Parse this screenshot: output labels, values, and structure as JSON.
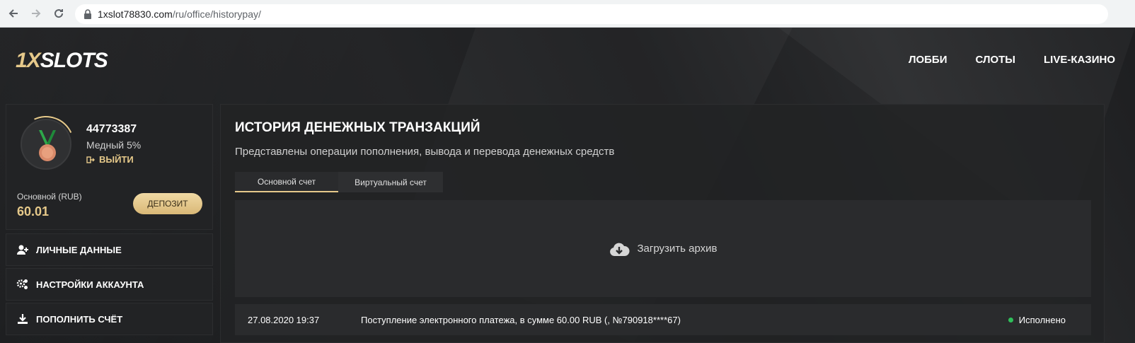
{
  "browser": {
    "domain": "1xslot78830.com",
    "path": "/ru/office/historypay/"
  },
  "header": {
    "logo_one": "1X",
    "logo_rest": "SLOTS",
    "nav": [
      "ЛОББИ",
      "СЛОТЫ",
      "LIVE-КАЗИНО"
    ]
  },
  "profile": {
    "user_id": "44773387",
    "level": "Медный 5%",
    "logout": "ВЫЙТИ",
    "balance_label": "Основной (RUB)",
    "balance_value": "60.01",
    "deposit": "ДЕПОЗИТ"
  },
  "menu": [
    {
      "label": "ЛИЧНЫЕ ДАННЫЕ",
      "icon": "user-plus-icon"
    },
    {
      "label": "НАСТРОЙКИ АККАУНТА",
      "icon": "gears-icon"
    },
    {
      "label": "ПОПОЛНИТЬ СЧЁТ",
      "icon": "download-icon"
    }
  ],
  "main": {
    "title": "ИСТОРИЯ ДЕНЕЖНЫХ ТРАНЗАКЦИЙ",
    "subtitle": "Представлены операции пополнения, вывода и перевода денежных средств",
    "tabs": [
      "Основной счет",
      "Виртуальный счет"
    ],
    "archive": "Загрузить архив",
    "transactions": [
      {
        "date": "27.08.2020 19:37",
        "description": "Поступление электронного платежа, в сумме 60.00 RUB (, №790918****67)",
        "status": "Исполнено"
      }
    ]
  },
  "colors": {
    "accent": "#e6c98a",
    "status_ok": "#2fbf5a"
  }
}
